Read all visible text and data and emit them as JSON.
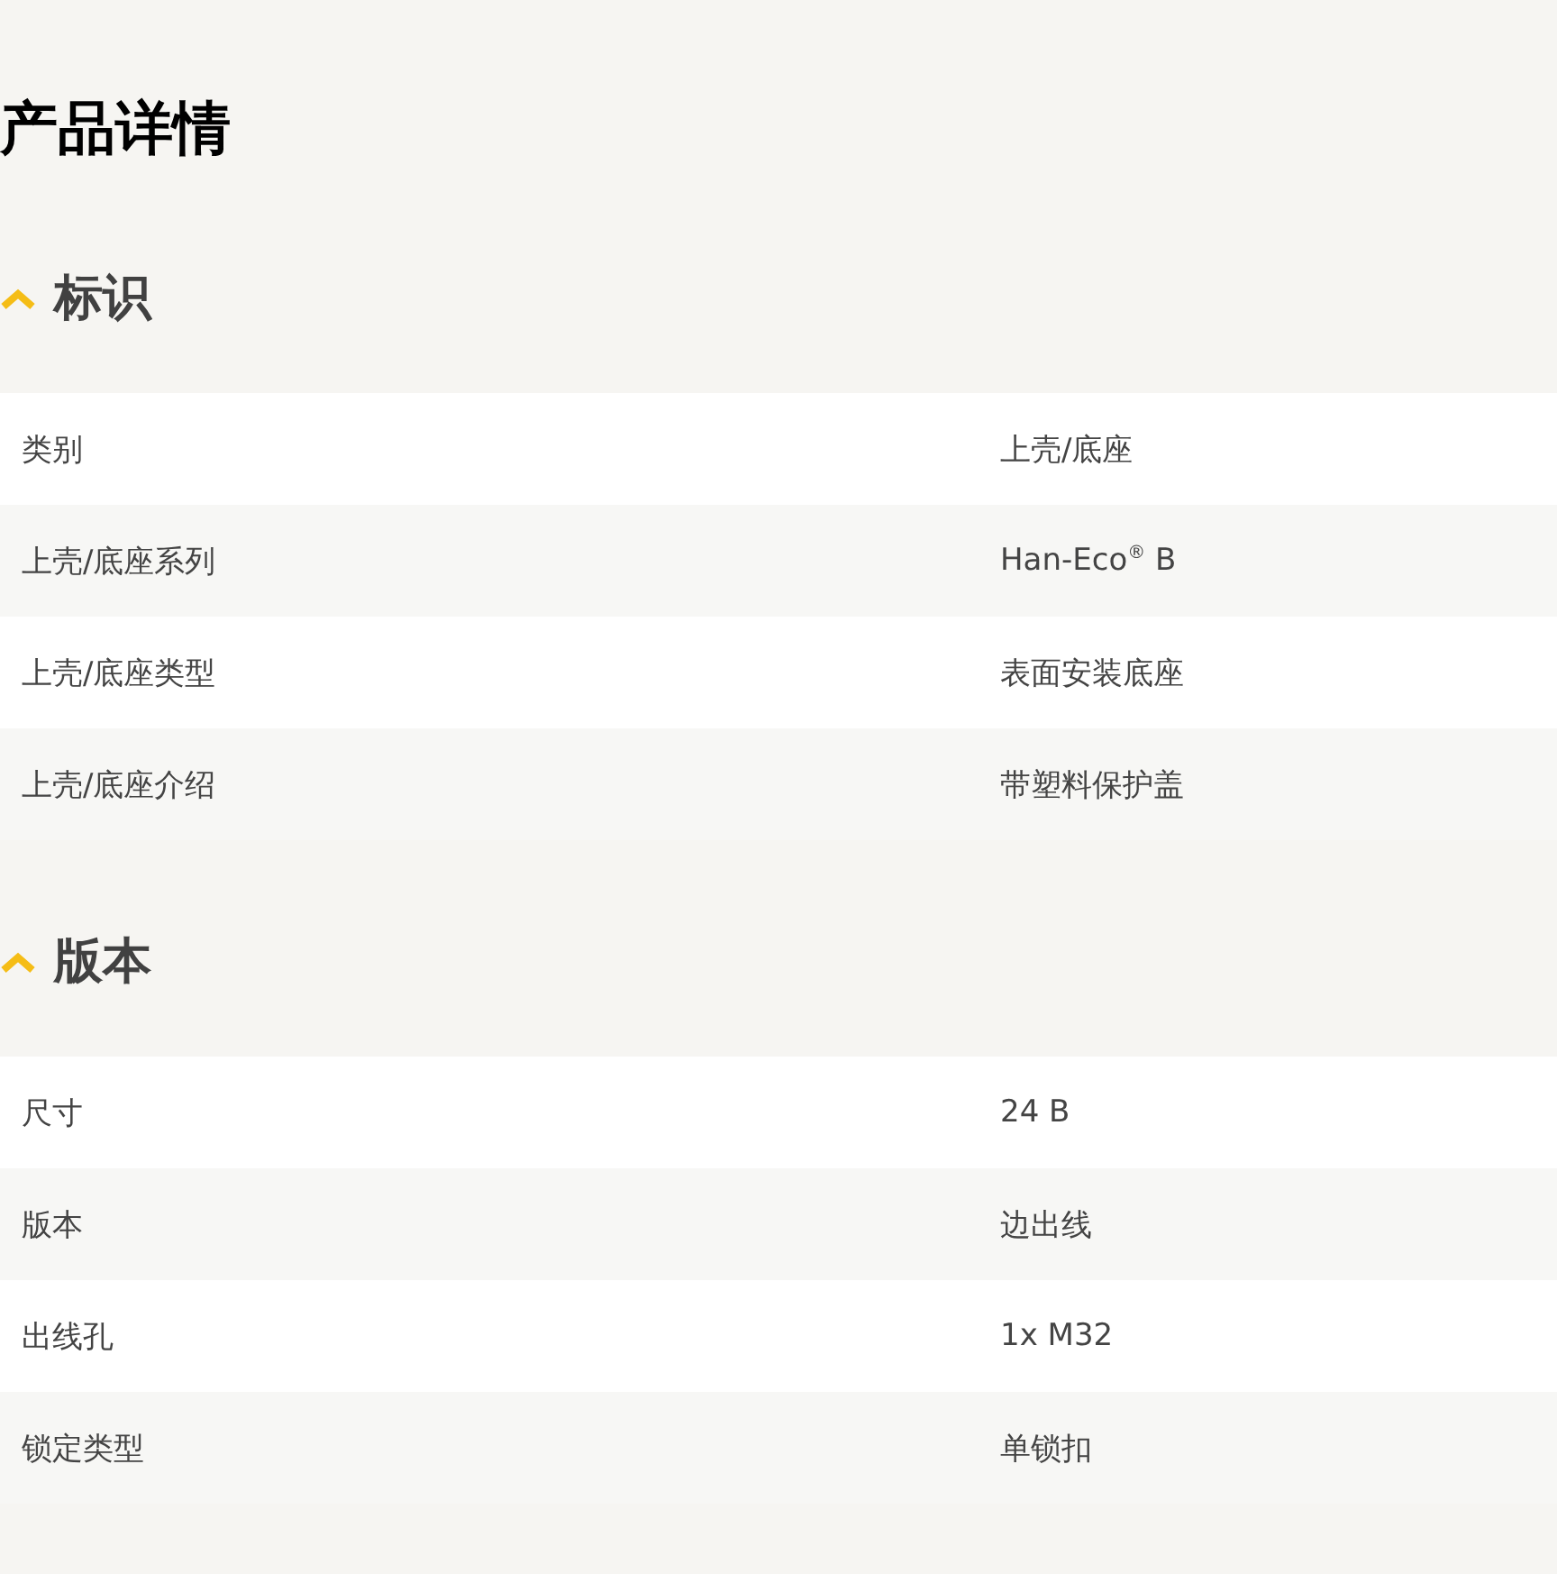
{
  "title": "产品详情",
  "sections": [
    {
      "heading": "标识",
      "expanded": true,
      "rows": [
        {
          "label": "类别",
          "value": "上壳/底座"
        },
        {
          "label": "上壳/底座系列",
          "value": "Han-Eco$^{®}$ B"
        },
        {
          "label": "上壳/底座类型",
          "value": "表面安装底座"
        },
        {
          "label": "上壳/底座介绍",
          "value": "带塑料保护盖"
        }
      ]
    },
    {
      "heading": "版本",
      "expanded": true,
      "rows": [
        {
          "label": "尺寸",
          "value": "24 B"
        },
        {
          "label": "版本",
          "value": "边出线"
        },
        {
          "label": "出线孔",
          "value": "1x M32"
        },
        {
          "label": "锁定类型",
          "value": "单锁扣"
        }
      ]
    }
  ]
}
